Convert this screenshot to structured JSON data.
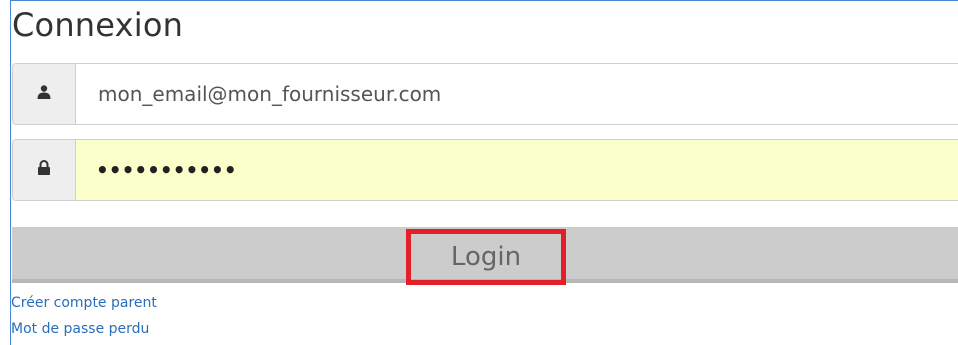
{
  "form": {
    "title": "Connexion",
    "email": {
      "value": "mon_email@mon_fournisseur.com",
      "icon": "user-icon"
    },
    "password": {
      "masked_value": "•••••••••••",
      "icon": "lock-icon",
      "autofill_color": "#fbffc9"
    },
    "login_label": "Login",
    "highlight_color": "#e3202a",
    "links": {
      "create_parent": "Créer compte parent",
      "lost_password": "Mot de passe perdu"
    },
    "link_color": "#2a6ebb"
  }
}
